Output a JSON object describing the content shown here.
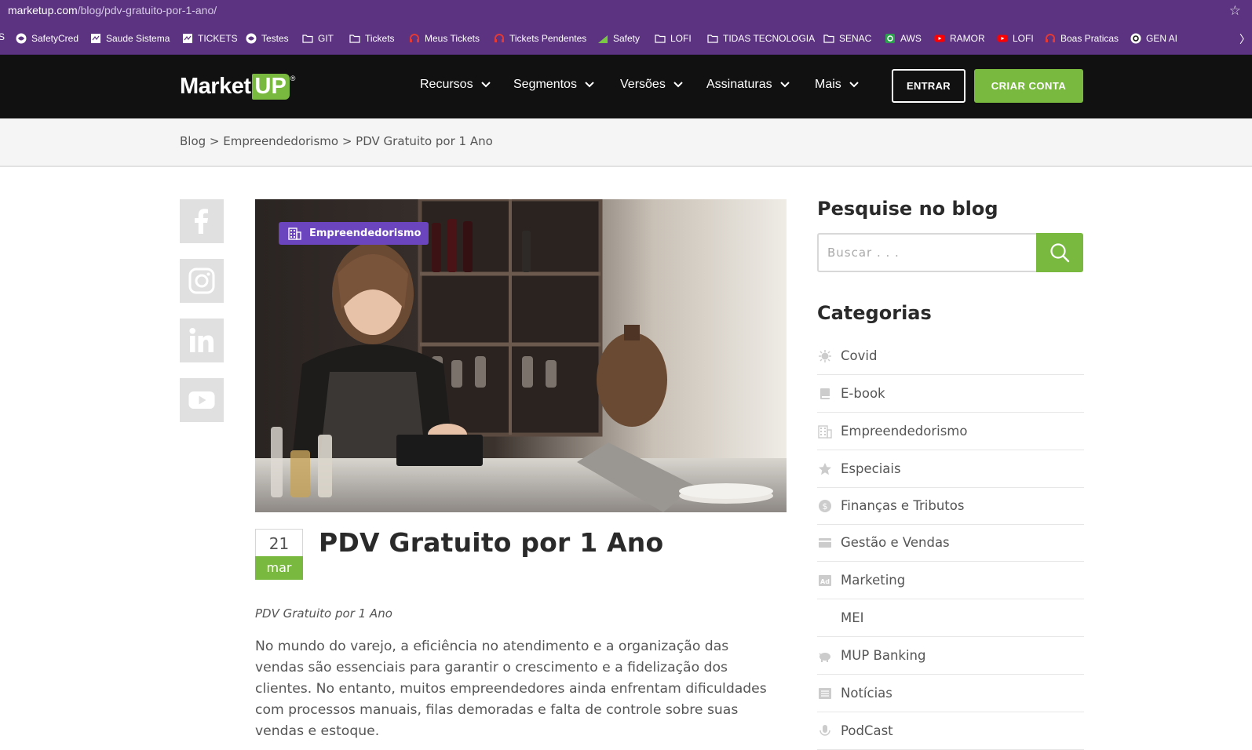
{
  "browser": {
    "url_domain": "marketup.com",
    "url_path": "/blog/pdv-gratuito-por-1-ano/",
    "left_edge_char": "S",
    "right_edge_char": "〉",
    "bookmarks": [
      {
        "label": "SafetyCred",
        "icon": "globe-icon"
      },
      {
        "label": "Saude Sistema",
        "icon": "page-icon"
      },
      {
        "label": "TICKETS",
        "icon": "page-icon"
      },
      {
        "label": "Testes",
        "icon": "globe-icon"
      },
      {
        "label": "GIT",
        "icon": "folder-icon"
      },
      {
        "label": "Tickets",
        "icon": "folder-icon"
      },
      {
        "label": "Meus Tickets",
        "icon": "headset-icon"
      },
      {
        "label": "Tickets Pendentes",
        "icon": "headset-icon"
      },
      {
        "label": "Safety",
        "icon": "green-flag-icon"
      },
      {
        "label": "LOFI",
        "icon": "folder-icon"
      },
      {
        "label": "TIDAS TECNOLOGIA",
        "icon": "folder-icon"
      },
      {
        "label": "SENAC",
        "icon": "folder-icon"
      },
      {
        "label": "AWS",
        "icon": "green-app-icon"
      },
      {
        "label": "RAMOR",
        "icon": "youtube-icon"
      },
      {
        "label": "LOFI",
        "icon": "youtube-icon"
      },
      {
        "label": "Boas Praticas",
        "icon": "headset-icon"
      },
      {
        "label": "GEN AI",
        "icon": "openai-icon"
      }
    ]
  },
  "header": {
    "logo_market": "Market",
    "logo_up": "UP",
    "logo_reg": "®",
    "nav": [
      "Recursos",
      "Segmentos",
      "Versões",
      "Assinaturas",
      "Mais"
    ],
    "entrar": "ENTRAR",
    "criar_conta": "CRIAR CONTA"
  },
  "breadcrumb": "Blog > Empreendedorismo > PDV Gratuito por 1 Ano",
  "article": {
    "category_badge": "Empreendedorismo",
    "date_day": "21",
    "date_month": "mar",
    "title": "PDV Gratuito por 1 Ano",
    "subtitle": "PDV Gratuito por 1 Ano",
    "body": "No mundo do varejo, a eficiência no atendimento e a organização das vendas são essenciais para garantir o crescimento e a fidelização dos clientes. No entanto, muitos empreendedores ainda enfrentam dificuldades com processos manuais, filas demoradas e falta de controle sobre suas vendas e estoque."
  },
  "sidebar": {
    "search_heading": "Pesquise no blog",
    "search_placeholder": "Buscar . . .",
    "categories_heading": "Categorias",
    "categories": [
      {
        "label": "Covid",
        "icon": "virus-icon"
      },
      {
        "label": "E-book",
        "icon": "book-icon"
      },
      {
        "label": "Empreendedorismo",
        "icon": "building-icon"
      },
      {
        "label": "Especiais",
        "icon": "star-icon"
      },
      {
        "label": "Finanças e Tributos",
        "icon": "dollar-icon"
      },
      {
        "label": "Gestão e Vendas",
        "icon": "card-icon"
      },
      {
        "label": "Marketing",
        "icon": "ad-icon"
      },
      {
        "label": "MEI",
        "icon": "none"
      },
      {
        "label": "MUP Banking",
        "icon": "piggy-bank-icon"
      },
      {
        "label": "Notícias",
        "icon": "newspaper-icon"
      },
      {
        "label": "PodCast",
        "icon": "microphone-icon"
      }
    ]
  },
  "colors": {
    "browser_bar": "#5b3380",
    "header_bg": "#111111",
    "brand_green": "#7ab93f",
    "badge_purple": "#6a45bd"
  }
}
